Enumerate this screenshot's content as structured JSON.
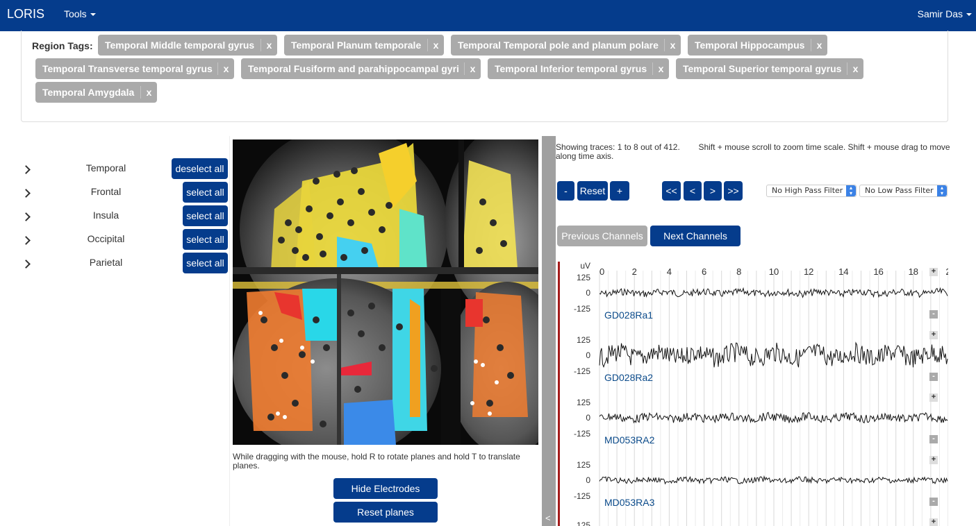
{
  "navbar": {
    "brand": "LORIS",
    "tools_label": "Tools",
    "user_label": "Samir Das"
  },
  "region_tags": {
    "label": "Region Tags:",
    "remove_label": "x",
    "tags": [
      "Temporal Middle temporal gyrus",
      "Temporal Planum temporale",
      "Temporal Temporal pole and planum polare",
      "Temporal Hippocampus",
      "Temporal Transverse temporal gyrus",
      "Temporal Fusiform and parahippocampal gyri",
      "Temporal Inferior temporal gyrus",
      "Temporal Superior temporal gyrus",
      "Temporal Amygdala"
    ]
  },
  "regions": [
    {
      "name": "Temporal",
      "button": "deselect all"
    },
    {
      "name": "Frontal",
      "button": "select all"
    },
    {
      "name": "Insula",
      "button": "select all"
    },
    {
      "name": "Occipital",
      "button": "select all"
    },
    {
      "name": "Parietal",
      "button": "select all"
    }
  ],
  "brain_viewer": {
    "caption": "While dragging with the mouse, hold R to rotate planes and hold T to translate planes.",
    "hide_electrodes": "Hide Electrodes",
    "reset_planes": "Reset planes",
    "collapse_label": "<"
  },
  "signal_viewer": {
    "traces_info": "Showing traces: 1 to 8 out of 412.",
    "help_text": "Shift + mouse scroll to zoom time scale. Shift + mouse drag to move along time axis.",
    "amplitude_controls": {
      "minus": "-",
      "reset": "Reset",
      "plus": "+"
    },
    "time_controls": [
      "<<",
      "<",
      ">",
      ">>"
    ],
    "high_pass_filter": "No High Pass Filter",
    "low_pass_filter": "No Low Pass Filter",
    "previous_channels": "Previous Channels",
    "next_channels": "Next Channels",
    "unit_label": "uV",
    "time_ticks": [
      "0",
      "2",
      "4",
      "6",
      "8",
      "10",
      "12",
      "14",
      "16",
      "18",
      "2"
    ],
    "amplitude_ticks": [
      "125",
      "0",
      "-125"
    ],
    "channels": [
      "GD028Ra1",
      "GD028Ra2",
      "MD053RA2",
      "MD053RA3"
    ],
    "channel_plus": "+",
    "channel_minus": "-",
    "colors": {
      "accent": "#053c8c",
      "channel_name": "#0a4a8a",
      "marker": "#a51c1c"
    }
  }
}
